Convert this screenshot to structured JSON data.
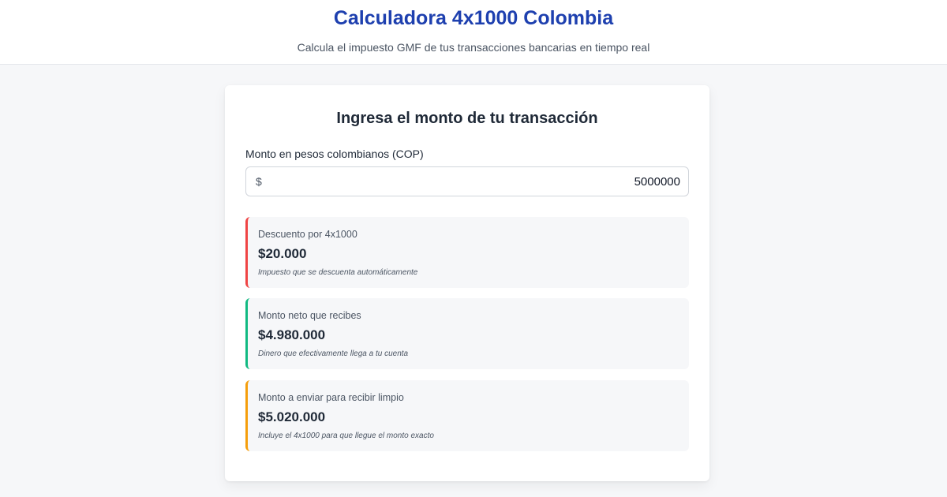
{
  "header": {
    "title": "Calculadora 4x1000 Colombia",
    "subtitle": "Calcula el impuesto GMF de tus transacciones bancarias en tiempo real"
  },
  "calculator": {
    "heading": "Ingresa el monto de tu transacción",
    "amount_label": "Monto en pesos colombianos (COP)",
    "currency_symbol": "$",
    "amount_value": "5000000"
  },
  "results": [
    {
      "label": "Descuento por 4x1000",
      "value": "$20.000",
      "note": "Impuesto que se descuenta automáticamente",
      "accent": "#ef4444"
    },
    {
      "label": "Monto neto que recibes",
      "value": "$4.980.000",
      "note": "Dinero que efectivamente llega a tu cuenta",
      "accent": "#10b981"
    },
    {
      "label": "Monto a enviar para recibir limpio",
      "value": "$5.020.000",
      "note": "Incluye el 4x1000 para que llegue el monto exacto",
      "accent": "#f59e0b"
    }
  ],
  "colors": {
    "brand": "#1e40af",
    "background": "#f6f7f9"
  }
}
